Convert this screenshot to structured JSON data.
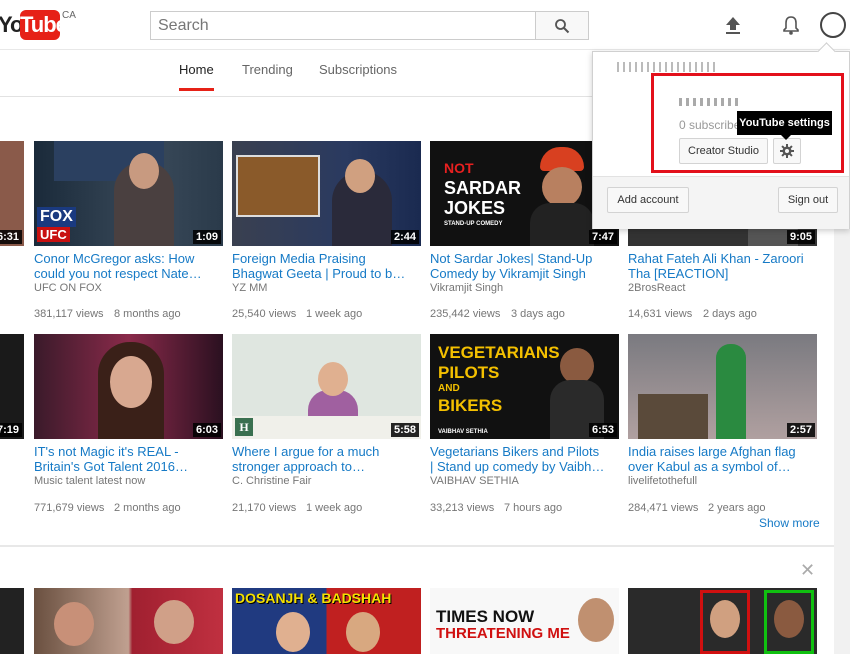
{
  "header": {
    "logo_you": "You",
    "logo_tube": "Tube",
    "country": "CA",
    "search_placeholder": "Search"
  },
  "nav": {
    "tabs": [
      "Home",
      "Trending",
      "Subscriptions"
    ],
    "active": "Home"
  },
  "account_popup": {
    "subscribers": "0 subscribe",
    "creator_studio": "Creator Studio",
    "tooltip": "YouTube settings",
    "add_account": "Add account",
    "sign_out": "Sign out"
  },
  "videos_row1": [
    {
      "duration": "1:09",
      "title1": "Conor McGregor asks: How",
      "title2": "could you not respect Nate…",
      "channel": "UFC ON FOX",
      "views": "381,117 views",
      "age": "8 months ago",
      "thumb_text1": "FOX",
      "thumb_text2": "UFC"
    },
    {
      "duration": "2:44",
      "title1": "Foreign Media Praising",
      "title2": "Bhagwat Geeta | Proud to b…",
      "channel": "YZ MM",
      "views": "25,540 views",
      "age": "1 week ago"
    },
    {
      "duration": "7:47",
      "title1": "Not Sardar Jokes| Stand-Up",
      "title2": "Comedy by Vikramjit Singh",
      "channel": "Vikramjit Singh",
      "views": "235,442 views",
      "age": "3 days ago",
      "thumb_text1": "NOT",
      "thumb_text2": "SARDAR",
      "thumb_text3": "JOKES",
      "thumb_text4": "STAND-UP COMEDY"
    },
    {
      "duration": "9:05",
      "title1": "Rahat Fateh Ali Khan - Zaroori",
      "title2": "Tha [REACTION]",
      "channel": "2BrosReact",
      "views": "14,631 views",
      "age": "2 days ago"
    }
  ],
  "videos_row2": [
    {
      "duration": "6:03",
      "title1": "IT's not Magic it's REAL -",
      "title2": "Britain's Got Talent 2016…",
      "channel": "Music talent latest now",
      "views": "771,679 views",
      "age": "2 months ago"
    },
    {
      "duration": "5:58",
      "title1": "Where I argue for a much",
      "title2": "stronger approach to…",
      "channel": "C. Christine Fair",
      "views": "21,170 views",
      "age": "1 week ago"
    },
    {
      "duration": "6:53",
      "title1": "Vegetarians Bikers and Pilots",
      "title2": "| Stand up comedy by Vaibh…",
      "channel": "VAIBHAV SETHIA",
      "views": "33,213 views",
      "age": "7 hours ago",
      "thumb_text1": "VEGETARIANS",
      "thumb_text2": "PILOTS",
      "thumb_text3": "AND",
      "thumb_text4": "BIKERS",
      "thumb_text5": "VAIBHAV SETHIA"
    },
    {
      "duration": "2:57",
      "title1": "India raises large Afghan flag",
      "title2": "over Kabul as a symbol of…",
      "channel": "livelifetothefull",
      "views": "284,471 views",
      "age": "2 years ago"
    }
  ],
  "left_partial_durations": [
    "6:31",
    "7:19"
  ],
  "show_more": "Show more",
  "close_symbol": "✕",
  "row3_thumb_texts": [
    "DOSANJH & BADSHAH",
    "TIMES NOW",
    "THREATENING ME"
  ]
}
